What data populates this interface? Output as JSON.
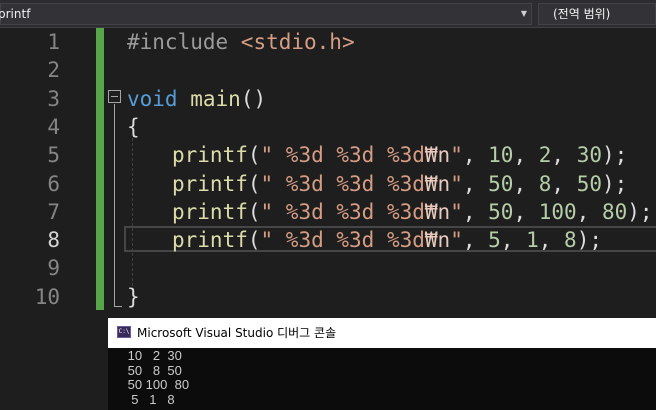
{
  "toolbar": {
    "member_dropdown": "printf",
    "scope_dropdown": "(전역 범위)"
  },
  "editor": {
    "line_numbers": [
      "1",
      "2",
      "3",
      "4",
      "5",
      "6",
      "7",
      "8",
      "9",
      "10"
    ],
    "current_line": "8",
    "colors": {
      "background": "#1e1e1e",
      "keyword": "#569cd6",
      "function": "#dcdcaa",
      "string": "#d69d85",
      "number": "#b5cea8",
      "preprocessor": "#9b9b9b",
      "change_bar": "#57a64a"
    },
    "code": {
      "include_directive": "#include ",
      "include_header": "<stdio.h>",
      "void_kw": "void",
      "main_name": "main",
      "main_parens": "()",
      "open_brace": "{",
      "close_brace": "}",
      "printf_name": "printf",
      "open_paren": "(",
      "close_stmt": ");",
      "comma": ", ",
      "format_string": "\" %3d %3d %3d",
      "escape_seq": "₩n",
      "quote": "\"",
      "calls": [
        {
          "args": [
            "10",
            "2",
            "30"
          ]
        },
        {
          "args": [
            "50",
            "8",
            "50"
          ]
        },
        {
          "args": [
            "50",
            "100",
            "80"
          ]
        },
        {
          "args": [
            "5",
            "1",
            "8"
          ]
        }
      ]
    }
  },
  "console": {
    "title": "Microsoft Visual Studio 디버그 콘솔",
    "icon": "console-app-icon",
    "output_lines": [
      " 10   2  30",
      " 50   8  50",
      " 50 100  80",
      "  5   1   8"
    ]
  }
}
